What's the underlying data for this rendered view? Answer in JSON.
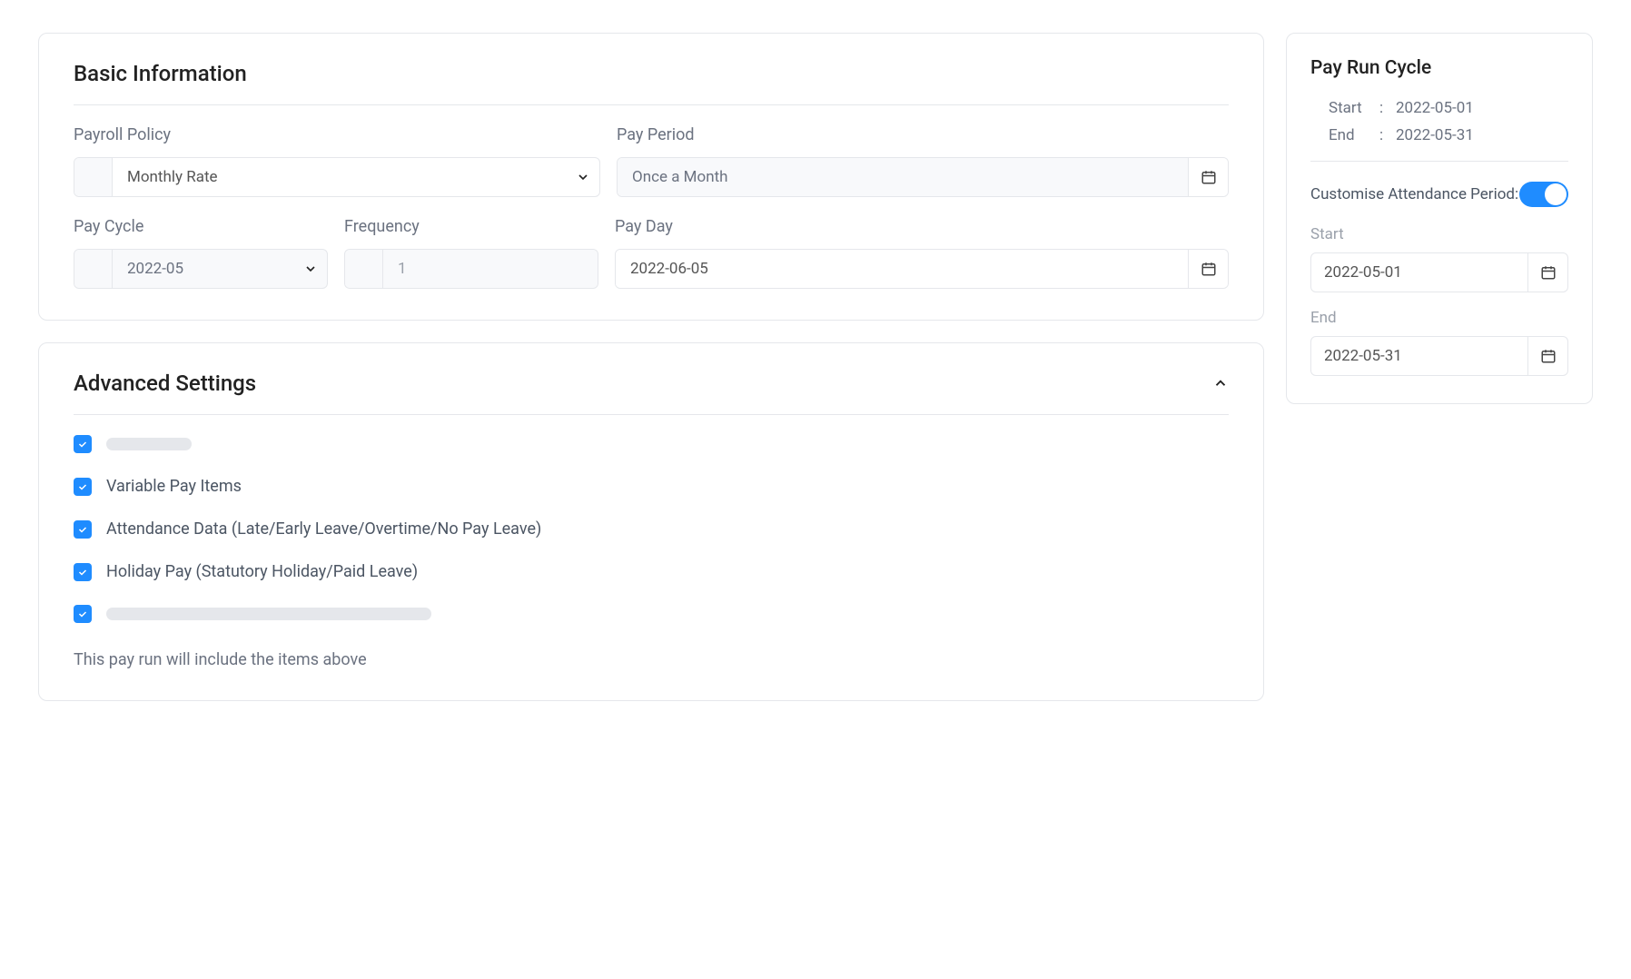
{
  "basic": {
    "title": "Basic Information",
    "payroll_policy": {
      "label": "Payroll Policy",
      "value": "Monthly Rate"
    },
    "pay_period": {
      "label": "Pay Period",
      "value": "Once a Month"
    },
    "pay_cycle": {
      "label": "Pay Cycle",
      "value": "2022-05"
    },
    "frequency": {
      "label": "Frequency",
      "value": "1"
    },
    "pay_day": {
      "label": "Pay Day",
      "value": "2022-06-05"
    }
  },
  "advanced": {
    "title": "Advanced Settings",
    "items": [
      {
        "checked": true,
        "label": "",
        "skeleton_width": 94
      },
      {
        "checked": true,
        "label": "Variable Pay Items"
      },
      {
        "checked": true,
        "label": "Attendance Data (Late/Early Leave/Overtime/No Pay Leave)"
      },
      {
        "checked": true,
        "label": "Holiday Pay (Statutory Holiday/Paid Leave)"
      },
      {
        "checked": true,
        "label": "",
        "skeleton_width": 358
      }
    ],
    "footnote": "This pay run will include the items above"
  },
  "side": {
    "title": "Pay Run Cycle",
    "start_label": "Start",
    "end_label": "End",
    "start_value": "2022-05-01",
    "end_value": "2022-05-31",
    "customise_label": "Customise Attendance Period:",
    "customise_on": true,
    "custom_start_label": "Start",
    "custom_start_value": "2022-05-01",
    "custom_end_label": "End",
    "custom_end_value": "2022-05-31"
  }
}
